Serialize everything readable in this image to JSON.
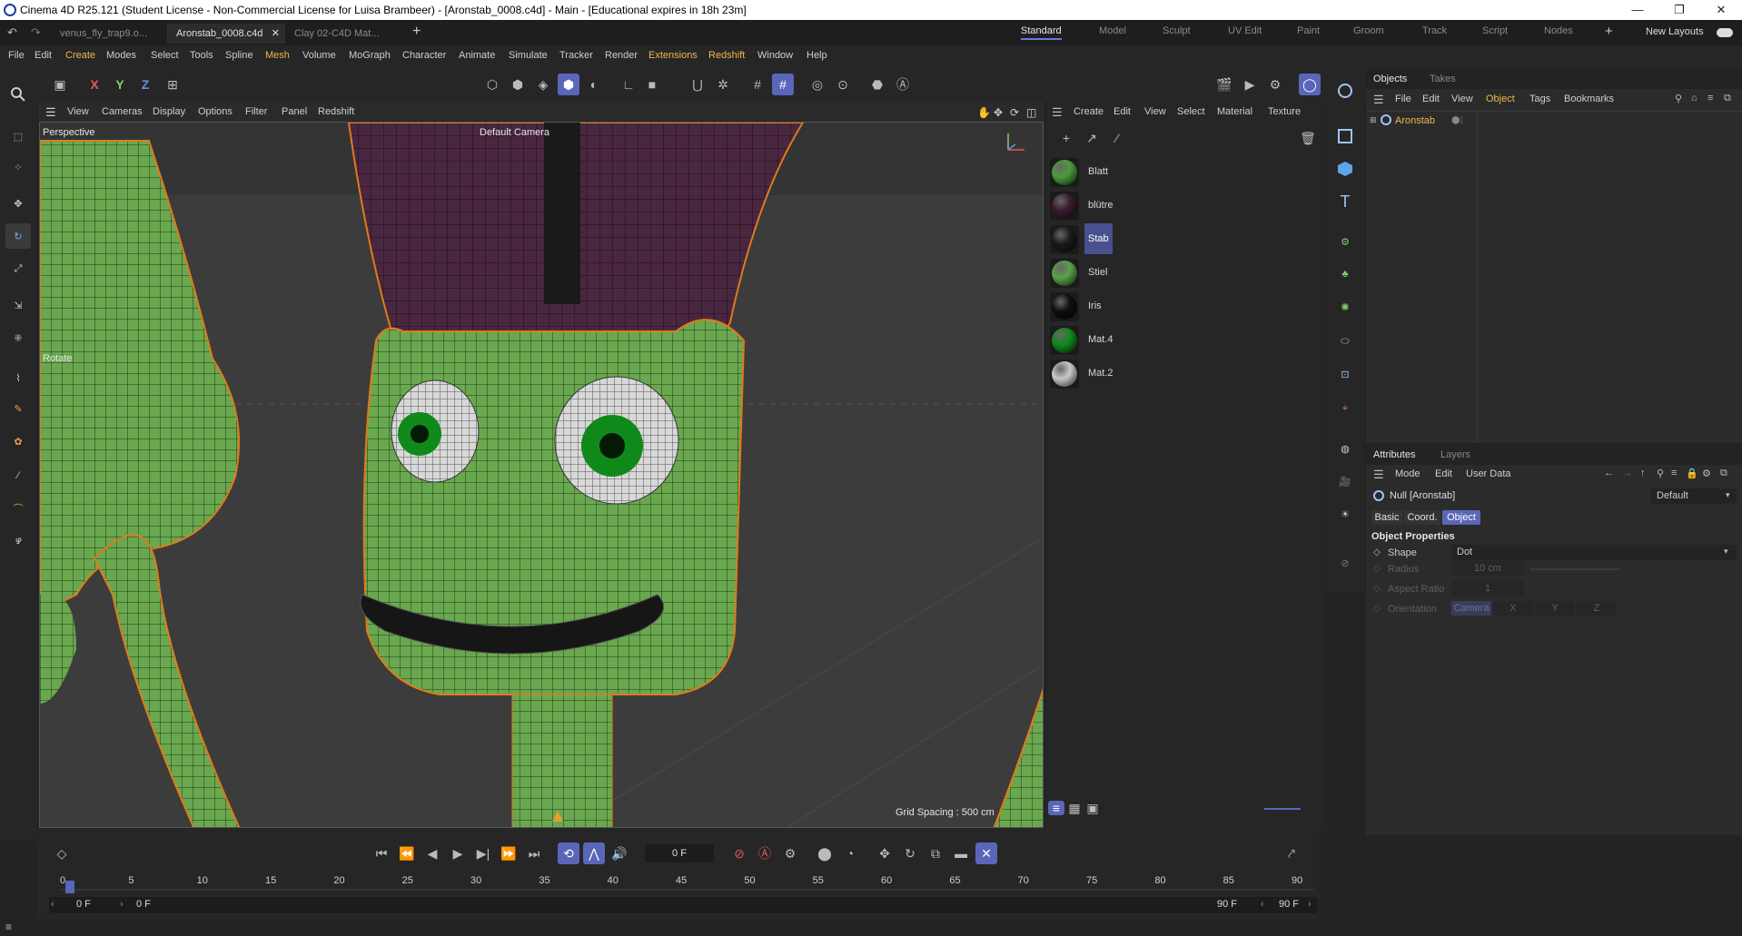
{
  "window": {
    "title": "Cinema 4D R25.121 (Student License - Non-Commercial License for Luisa Brambeer) - [Aronstab_0008.c4d] - Main - [Educational expires in 18h 23m]"
  },
  "doc_tabs": [
    "venus_fly_trap9.o...",
    "Aronstab_0008.c4d",
    "Clay 02-C4D Mat..."
  ],
  "layout_tabs": [
    "Standard",
    "Model",
    "Sculpt",
    "UV Edit",
    "Paint",
    "Groom",
    "Track",
    "Script",
    "Nodes"
  ],
  "new_layouts": "New Layouts",
  "menu": [
    "File",
    "Edit",
    "Create",
    "Modes",
    "Select",
    "Tools",
    "Spline",
    "Mesh",
    "Volume",
    "MoGraph",
    "Character",
    "Animate",
    "Simulate",
    "Tracker",
    "Render",
    "Extensions",
    "Redshift",
    "Window",
    "Help"
  ],
  "axes": {
    "x": "X",
    "y": "Y",
    "z": "Z"
  },
  "viewport": {
    "menu": [
      "View",
      "Cameras",
      "Display",
      "Options",
      "Filter",
      "Panel",
      "Redshift"
    ],
    "perspective": "Perspective",
    "camera": "Default Camera",
    "tool_label": "Rotate",
    "grid_spacing": "Grid Spacing : 500 cm"
  },
  "material_manager": {
    "menu": [
      "Create",
      "Edit",
      "View",
      "Select",
      "Material",
      "Texture"
    ],
    "materials": [
      {
        "name": "Blatt",
        "color": "#4a9c3a",
        "selected": false
      },
      {
        "name": "blütre",
        "color": "#3a1a30",
        "selected": false
      },
      {
        "name": "Stab",
        "color": "#1a1a1e",
        "selected": true
      },
      {
        "name": "Stiel",
        "color": "#5aa04a",
        "selected": false
      },
      {
        "name": "Iris",
        "color": "#0e0e0e",
        "selected": false
      },
      {
        "name": "Mat.4",
        "color": "#0f8a1a",
        "selected": false
      },
      {
        "name": "Mat.2",
        "color": "#c8c8c8",
        "selected": false
      }
    ]
  },
  "objects_panel": {
    "tabs": [
      "Objects",
      "Takes"
    ],
    "menu": [
      "File",
      "Edit",
      "View",
      "Object",
      "Tags",
      "Bookmarks"
    ],
    "objects": [
      "Aronstab"
    ]
  },
  "attributes": {
    "tabs": [
      "Attributes",
      "Layers"
    ],
    "menu": [
      "Mode",
      "Edit",
      "User Data"
    ],
    "object_name": "Null [Aronstab]",
    "preset": "Default",
    "subtabs": [
      "Basic",
      "Coord.",
      "Object"
    ],
    "section": "Object Properties",
    "shape_label": "Shape",
    "shape_value": "Dot",
    "radius_label": "Radius",
    "radius_value": "10 cm",
    "aspect_label": "Aspect Ratio",
    "aspect_value": "1",
    "orientation_label": "Orientation",
    "orientation_values": [
      "Camera",
      "X",
      "Y",
      "Z"
    ]
  },
  "timeline": {
    "current_frame": "0 F",
    "ticks": [
      "0",
      "5",
      "10",
      "15",
      "20",
      "25",
      "30",
      "35",
      "40",
      "45",
      "50",
      "55",
      "60",
      "65",
      "70",
      "75",
      "80",
      "85",
      "90"
    ],
    "start": "0 F",
    "range_start": "0 F",
    "range_end": "90 F",
    "end": "90 F"
  },
  "colors": {
    "accent": "#5a66b8",
    "highlight_menu": "#f2b552",
    "selection_outline": "#e07a1a"
  }
}
